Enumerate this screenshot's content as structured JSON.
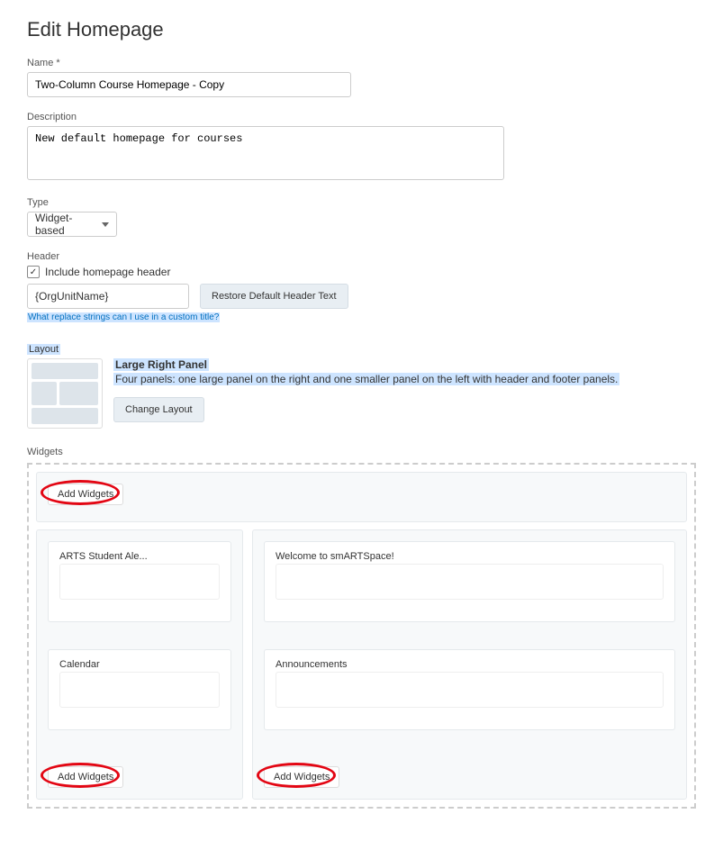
{
  "page": {
    "title": "Edit Homepage"
  },
  "name": {
    "label": "Name *",
    "value": "Two-Column Course Homepage - Copy"
  },
  "description": {
    "label": "Description",
    "value": "New default homepage for courses"
  },
  "type": {
    "label": "Type",
    "selected": "Widget-based"
  },
  "header": {
    "label": "Header",
    "checkbox_label": "Include homepage header",
    "value": "{OrgUnitName}",
    "restore_btn": "Restore Default Header Text",
    "help_link": "What replace strings can I use in a custom title?"
  },
  "layout": {
    "label": "Layout",
    "title": "Large Right Panel",
    "description": "Four panels: one large panel on the right and one smaller panel on the left with header and footer panels.",
    "change_btn": "Change Layout"
  },
  "widgets": {
    "label": "Widgets",
    "add_btn": "Add Widgets",
    "left": [
      {
        "title": "ARTS Student Ale..."
      },
      {
        "title": "Calendar"
      }
    ],
    "right": [
      {
        "title": "Welcome to smARTSpace!"
      },
      {
        "title": "Announcements"
      }
    ]
  }
}
